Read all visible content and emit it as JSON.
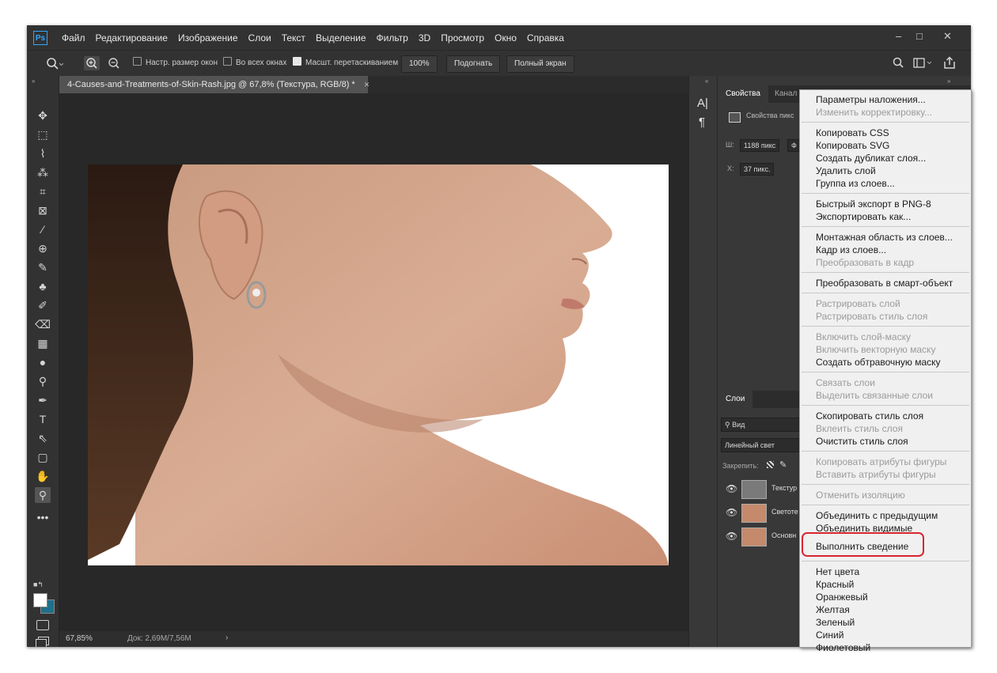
{
  "app": {
    "logo": "Ps"
  },
  "menubar": {
    "items": [
      "Файл",
      "Редактирование",
      "Изображение",
      "Слои",
      "Текст",
      "Выделение",
      "Фильтр",
      "3D",
      "Просмотр",
      "Окно",
      "Справка"
    ],
    "window_controls": [
      "–",
      "□",
      "✕"
    ]
  },
  "options_bar": {
    "cb_resize": "Настр. размер окон",
    "cb_all_windows": "Во всех окнах",
    "cb_scrubby": "Масшт. перетаскиванием",
    "zoom_value": "100%",
    "fit_button": "Подогнать",
    "fullscreen_button": "Полный экран"
  },
  "document": {
    "tab_title": "4-Causes-and-Treatments-of-Skin-Rash.jpg @ 67,8% (Текстура, RGB/8) *",
    "tab_close": "✕",
    "zoom": "67,85%",
    "doc_size": "Док: 2,69M/7,56M",
    "status_arrow": "›"
  },
  "properties_panel": {
    "tab_properties": "Свойства",
    "tab_channels": "Канал",
    "subtitle": "Свойства пикс",
    "w_label": "Ш:",
    "w_value": "1188 пикс",
    "w_extra": "Ф",
    "x_label": "X:",
    "x_value": "37 пикс."
  },
  "layers_panel": {
    "tab_layers": "Слои",
    "filter_value": "Вид",
    "blend_mode": "Линейный свет",
    "lock_label": "Закрепить:",
    "layers": [
      {
        "name": "Текстур"
      },
      {
        "name": "Светоте"
      },
      {
        "name": "Основн"
      }
    ]
  },
  "context_menu": {
    "groups": [
      [
        {
          "label": "Параметры наложения...",
          "disabled": false
        },
        {
          "label": "Изменить корректировку...",
          "disabled": true
        }
      ],
      [
        {
          "label": "Копировать CSS",
          "disabled": false
        },
        {
          "label": "Копировать SVG",
          "disabled": false
        },
        {
          "label": "Создать дубликат слоя...",
          "disabled": false
        },
        {
          "label": "Удалить слой",
          "disabled": false
        },
        {
          "label": "Группа из слоев...",
          "disabled": false
        }
      ],
      [
        {
          "label": "Быстрый экспорт в PNG-8",
          "disabled": false
        },
        {
          "label": "Экспортировать как...",
          "disabled": false
        }
      ],
      [
        {
          "label": "Монтажная область из слоев...",
          "disabled": false
        },
        {
          "label": "Кадр из слоев...",
          "disabled": false
        },
        {
          "label": "Преобразовать в кадр",
          "disabled": true
        }
      ],
      [
        {
          "label": "Преобразовать в смарт-объект",
          "disabled": false
        }
      ],
      [
        {
          "label": "Растрировать слой",
          "disabled": true
        },
        {
          "label": "Растрировать стиль слоя",
          "disabled": true
        }
      ],
      [
        {
          "label": "Включить слой-маску",
          "disabled": true
        },
        {
          "label": "Включить векторную маску",
          "disabled": true
        },
        {
          "label": "Создать обтравочную маску",
          "disabled": false
        }
      ],
      [
        {
          "label": "Связать слои",
          "disabled": true
        },
        {
          "label": "Выделить связанные слои",
          "disabled": true
        }
      ],
      [
        {
          "label": "Скопировать стиль слоя",
          "disabled": false
        },
        {
          "label": "Вклеить стиль слоя",
          "disabled": true
        },
        {
          "label": "Очистить стиль слоя",
          "disabled": false
        }
      ],
      [
        {
          "label": "Копировать атрибуты фигуры",
          "disabled": true
        },
        {
          "label": "Вставить атрибуты фигуры",
          "disabled": true
        }
      ],
      [
        {
          "label": "Отменить изоляцию",
          "disabled": true
        }
      ],
      [
        {
          "label": "Объединить с предыдущим",
          "disabled": false
        },
        {
          "label": "Объединить видимые",
          "disabled": false
        },
        {
          "label": "Выполнить сведение",
          "disabled": false,
          "highlighted": true
        }
      ],
      [
        {
          "label": "Нет цвета",
          "disabled": false
        },
        {
          "label": "Красный",
          "disabled": false
        },
        {
          "label": "Оранжевый",
          "disabled": false
        },
        {
          "label": "Желтая",
          "disabled": false
        },
        {
          "label": "Зеленый",
          "disabled": false
        },
        {
          "label": "Синий",
          "disabled": false
        },
        {
          "label": "Фиолетовый",
          "disabled": false
        }
      ]
    ]
  },
  "colors": {
    "app_bg": "#323232",
    "canvas_bg": "#282828",
    "accent_ps": "#31a8ff",
    "highlight_border": "#d9252f",
    "background_color_swatch": "#1f6f8b"
  },
  "icons": {
    "tools": [
      "move-icon",
      "marquee-icon",
      "lasso-icon",
      "magic-wand-icon",
      "crop-icon",
      "frame-icon",
      "eyedropper-icon",
      "healing-brush-icon",
      "brush-icon",
      "clone-stamp-icon",
      "history-brush-icon",
      "eraser-icon",
      "gradient-icon",
      "blur-icon",
      "dodge-icon",
      "pen-icon",
      "type-icon",
      "path-selection-icon",
      "rectangle-icon",
      "hand-icon",
      "zoom-icon",
      "more-tools-icon"
    ]
  }
}
